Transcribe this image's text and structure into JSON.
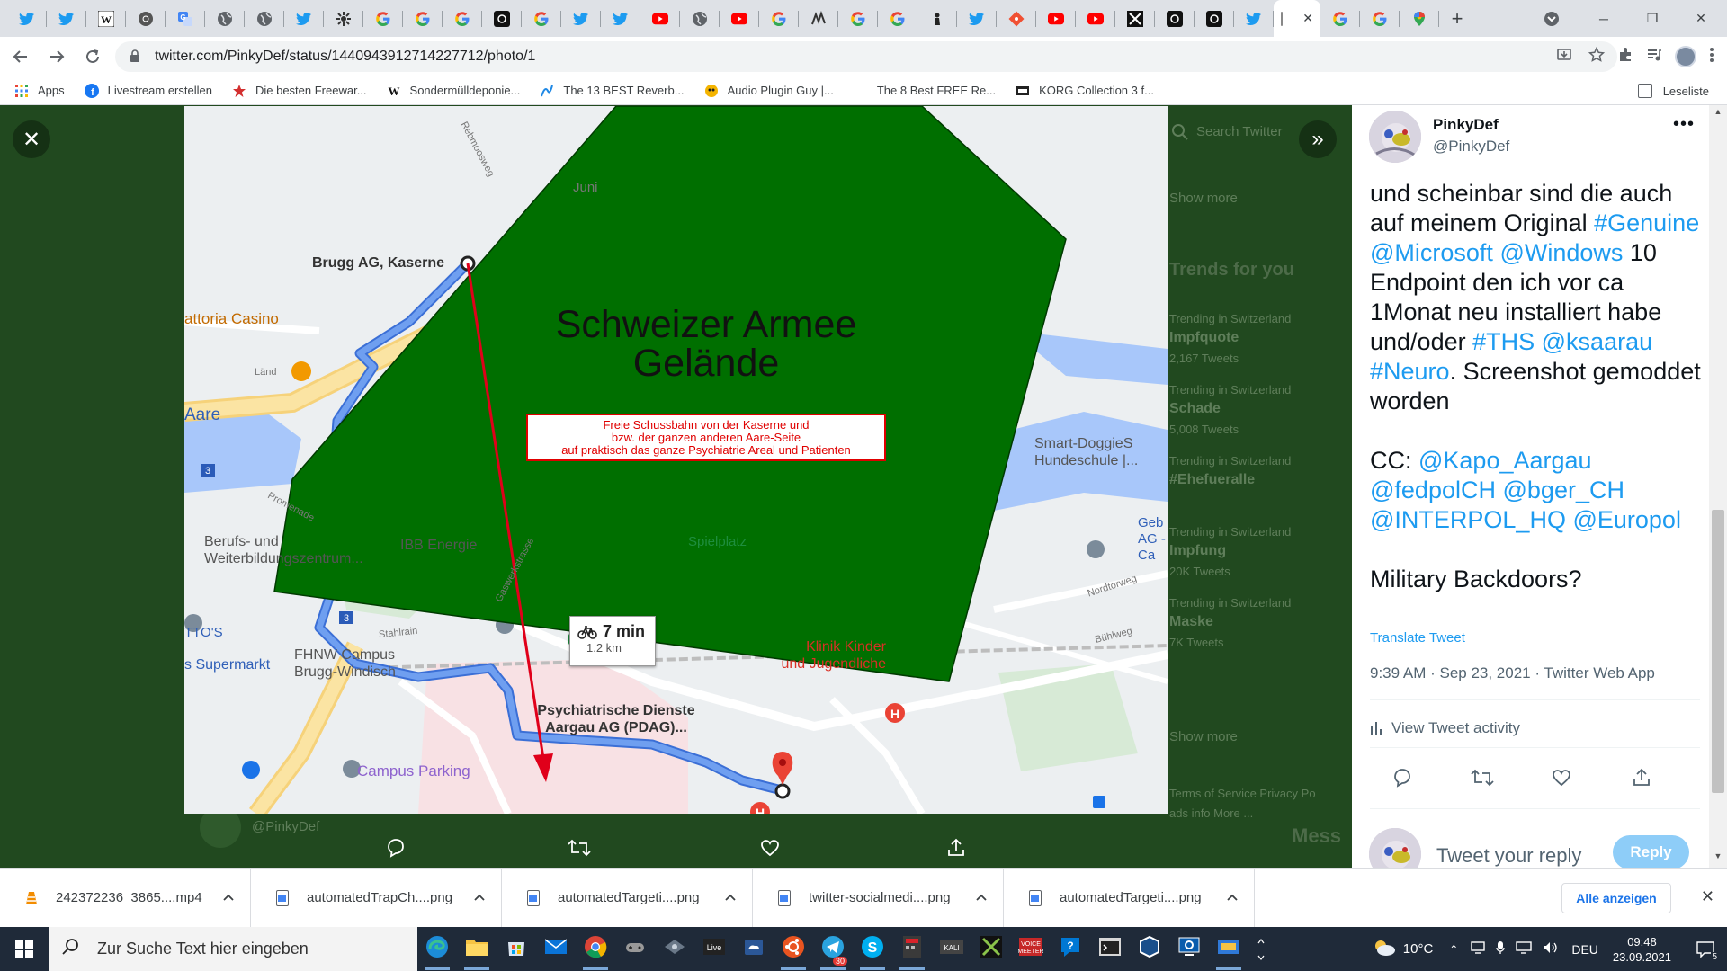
{
  "tabs": {
    "active_close": "✕",
    "new_tab": "+"
  },
  "window": {
    "minimize": "─",
    "restore": "❐",
    "close": "✕",
    "profile_glyph": "⌄"
  },
  "omnibox": {
    "url": "twitter.com/PinkyDef/status/1440943912714227712/photo/1"
  },
  "bookmarks": {
    "items": [
      {
        "label": "Apps"
      },
      {
        "label": "Livestream erstellen"
      },
      {
        "label": "Die besten Freewar..."
      },
      {
        "label": "Sondermülldeponie..."
      },
      {
        "label": "The 13 BEST Reverb..."
      },
      {
        "label": "Audio Plugin Guy |..."
      },
      {
        "label": "The 8 Best FREE Re..."
      },
      {
        "label": "KORG Collection 3 f..."
      }
    ],
    "reading_list": "Leseliste"
  },
  "viewer": {
    "close_glyph": "✕",
    "next_glyph": "»",
    "background_color": "#21491f"
  },
  "map": {
    "overlay_title_line1": "Schweizer Armee",
    "overlay_title_line2": "Gelände",
    "warning_line1": "Freie Schussbahn von der Kaserne und",
    "warning_line2": "bzw. der ganzen anderen Aare-Seite",
    "warning_line3": "auf praktisch das ganze Psychiatrie Areal und Patienten",
    "start_label": "Brugg AG, Kaserne",
    "end_label_line1": "Psychiatrische Dienste",
    "end_label_line2": "Aargau AG (PDAG)...",
    "route_time": "7 min",
    "route_distance": "1.2 km",
    "places": {
      "casino": "attoria Casino",
      "aare": "Aare",
      "berufs1": "Berufs- und",
      "berufs2": "Weiterbildungszentrum...",
      "ibb": "IBB Energie",
      "spielplatz": "Spielplatz",
      "smartdoggies1": "Smart-DoggieS",
      "smartdoggies2": "Hundeschule |...",
      "geb1": "Geb",
      "geb2": "AG - Ca",
      "klinik1": "Klinik Kinder",
      "klinik2": "und Jugendliche",
      "fhnw1": "FHNW Campus",
      "fhnw2": "Brugg-Windisch",
      "supermarkt": "s Supermarkt",
      "ttos": "TTO'S",
      "campus_parking": "Campus Parking",
      "nordtorweg": "Nordtorweg",
      "buehlweg": "Bühlweg",
      "stahlrain": "Stahlrain",
      "promenade": "Promenade",
      "rebmoosweg": "Rebmoosweg",
      "gaswerkstrasse": "Gaswerkstrasse",
      "juni": "Juni",
      "laend": "Länd"
    },
    "route_numbers": [
      "5",
      "3",
      "3"
    ],
    "colors": {
      "overlay_green": "#006f00",
      "route_blue": "#6f9ff0",
      "arrow_red": "#e0001a",
      "warning_red": "#e00000"
    }
  },
  "background_twitter": {
    "search_placeholder": "Search Twitter",
    "show_more_1": "Show more",
    "trends_heading": "Trends for you",
    "trends": [
      {
        "context": "Trending in Switzerland",
        "name": "Impfquote",
        "count": "2,167 Tweets"
      },
      {
        "context": "Trending in Switzerland",
        "name": "Schade",
        "count": "5,008 Tweets"
      },
      {
        "context": "Trending in Switzerland",
        "name": "#Ehefueralle",
        "count": ""
      },
      {
        "context": "Trending in Switzerland",
        "name": "Impfung",
        "count": "20K Tweets"
      },
      {
        "context": "Trending in Switzerland",
        "name": "Maske",
        "count": "7K Tweets"
      }
    ],
    "show_more_2": "Show more",
    "footer_1": "Terms of Service   Privacy Po",
    "footer_2": "ads info   More ...",
    "behind_handle": "@PinkyDef",
    "messages": "Mess"
  },
  "tweet": {
    "name": "PinkyDef",
    "handle": "@PinkyDef",
    "more": "•••",
    "text_html_parts": [
      {
        "t": "und scheinbar sind die auch auf meinem Original ",
        "link": false
      },
      {
        "t": "#Genuine",
        "link": true
      },
      {
        "t": " ",
        "link": false
      },
      {
        "t": "@Microsoft",
        "link": true
      },
      {
        "t": " ",
        "link": false
      },
      {
        "t": "@Windows",
        "link": true
      },
      {
        "t": " 10 Endpoint den ich vor ca 1Monat neu installiert habe und/oder ",
        "link": false
      },
      {
        "t": "#THS",
        "link": true
      },
      {
        "t": " ",
        "link": false
      },
      {
        "t": "@ksaarau",
        "link": true
      },
      {
        "t": " ",
        "link": false
      },
      {
        "t": "#Neuro",
        "link": true
      },
      {
        "t": ". Screenshot gemoddet worden",
        "link": false
      }
    ],
    "cc_parts": [
      {
        "t": "CC: ",
        "link": false
      },
      {
        "t": "@Kapo_Aargau",
        "link": true
      },
      {
        "t": " ",
        "link": false
      },
      {
        "t": "@fedpolCH",
        "link": true
      },
      {
        "t": " ",
        "link": false
      },
      {
        "t": "@bger_CH",
        "link": true
      },
      {
        "t": " ",
        "link": false
      },
      {
        "t": "@INTERPOL_HQ",
        "link": true
      },
      {
        "t": " ",
        "link": false
      },
      {
        "t": "@Europol",
        "link": true
      }
    ],
    "question": "Military Backdoors?",
    "translate": "Translate Tweet",
    "meta": "9:39 AM · Sep 23, 2021 · Twitter Web App",
    "activity": "View Tweet activity",
    "reply_placeholder": "Tweet your reply",
    "reply_button": "Reply",
    "link_color": "#1d9bf0"
  },
  "downloads": {
    "items": [
      {
        "name": "242372236_3865....mp4",
        "type": "vlc"
      },
      {
        "name": "automatedTrapCh....png",
        "type": "file"
      },
      {
        "name": "automatedTargeti....png",
        "type": "file"
      },
      {
        "name": "twitter-socialmedi....png",
        "type": "file"
      },
      {
        "name": "automatedTargeti....png",
        "type": "file"
      }
    ],
    "show_all": "Alle anzeigen",
    "close": "✕"
  },
  "taskbar": {
    "search_placeholder": "Zur Suche Text hier eingeben",
    "weather": "10°C",
    "language": "DEU",
    "time": "09:48",
    "date": "23.09.2021",
    "notification_count": "5",
    "live_label": "Live",
    "kali_label": "KALI",
    "voicemeeter_label": "VOICE MEETER",
    "telegram_badge": "30"
  }
}
